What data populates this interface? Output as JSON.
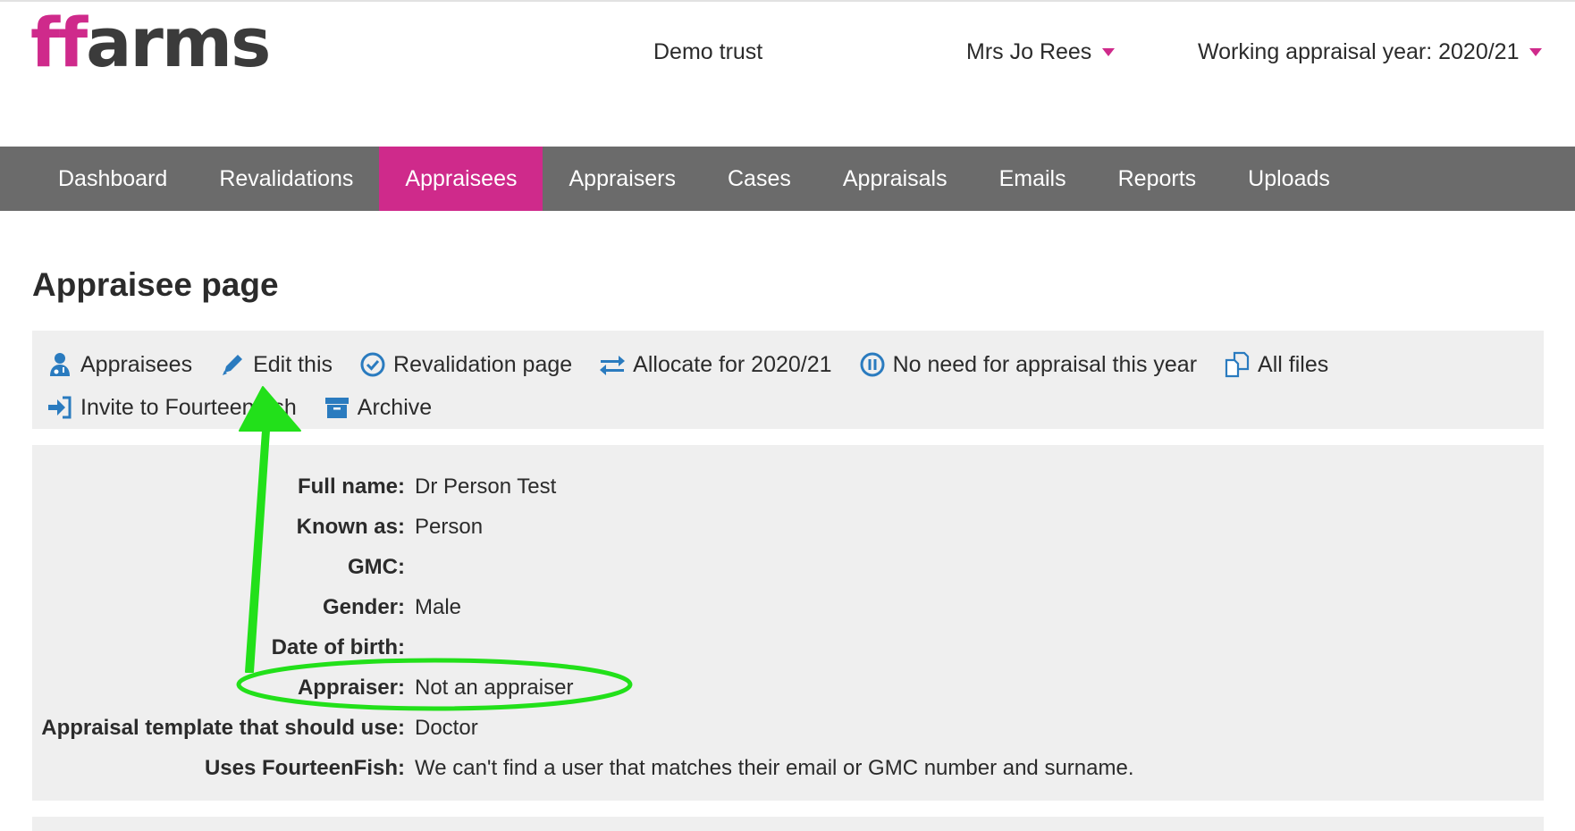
{
  "header": {
    "logo": {
      "ff": "ff",
      "rest": "arms"
    },
    "trust": "Demo trust",
    "user": "Mrs Jo Rees",
    "appraisal_year": "Working appraisal year: 2020/21"
  },
  "nav": {
    "items": [
      {
        "label": "Dashboard"
      },
      {
        "label": "Revalidations"
      },
      {
        "label": "Appraisees"
      },
      {
        "label": "Appraisers"
      },
      {
        "label": "Cases"
      },
      {
        "label": "Appraisals"
      },
      {
        "label": "Emails"
      },
      {
        "label": "Reports"
      },
      {
        "label": "Uploads"
      }
    ],
    "active": "Appraisees"
  },
  "page": {
    "title": "Appraisee page"
  },
  "actions": {
    "appraisees": "Appraisees",
    "edit": "Edit this",
    "revalidation": "Revalidation page",
    "allocate": "Allocate for 2020/21",
    "no_need": "No need for appraisal this year",
    "all_files": "All files",
    "invite": "Invite to FourteenFish",
    "archive": "Archive"
  },
  "details": {
    "rows": [
      {
        "label": "Full name:",
        "value": "Dr Person Test"
      },
      {
        "label": "Known as:",
        "value": "Person"
      },
      {
        "label": "GMC:",
        "value": ""
      },
      {
        "label": "Gender:",
        "value": "Male"
      },
      {
        "label": "Date of birth:",
        "value": ""
      },
      {
        "label": "Appraiser:",
        "value": "Not an appraiser"
      },
      {
        "label": "Appraisal template that should use:",
        "value": "Doctor"
      },
      {
        "label": "Uses FourteenFish:",
        "value": "We can't find a user that matches their email or GMC number and surname."
      }
    ]
  },
  "colors": {
    "brand_magenta": "#cf2a8b",
    "nav_gray": "#6b6b6b",
    "panel_gray": "#efefef",
    "icon_blue": "#2a7bbf",
    "annotation_green": "#22e01a"
  },
  "icons": {
    "appraisees": "user-doctor-icon",
    "edit": "pencil-icon",
    "revalidation": "check-circle-icon",
    "allocate": "exchange-arrows-icon",
    "no_need": "pause-circle-icon",
    "all_files": "copy-files-icon",
    "invite": "sign-in-icon",
    "archive": "archive-box-icon"
  }
}
